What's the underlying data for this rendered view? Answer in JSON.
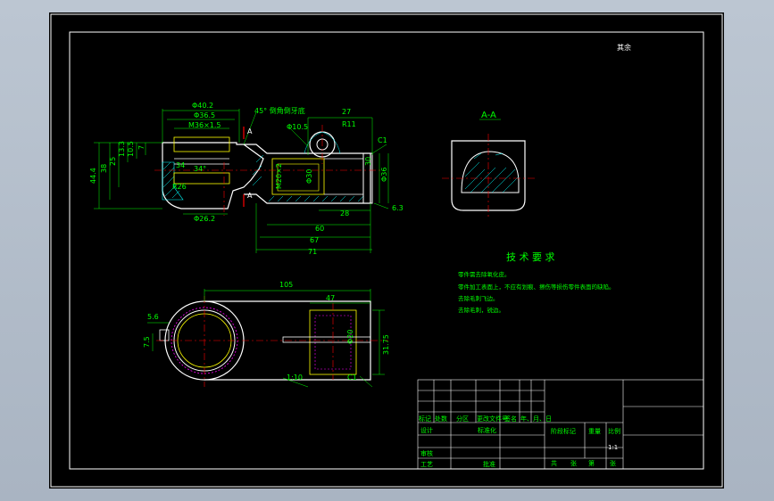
{
  "drawing": {
    "code": "其余",
    "section_title": "A-A",
    "dimensions": {
      "d1": "Φ40.2",
      "d2": "Φ36.5",
      "d3": "M36×1.5",
      "d4": "45° 倒角倒牙底",
      "d5": "27",
      "d6": "R11",
      "d7": "Φ10.5",
      "d8": "C1",
      "d9": "44.4",
      "d10": "38",
      "d11": "25",
      "d12": "13.3",
      "d13": "10.5",
      "d14": "7",
      "d15": "Φ30",
      "d16": "Φ36",
      "d17": "R26",
      "d18": "34°",
      "d19": "Φ26.2",
      "d20": "28",
      "d21": "6.3",
      "d22": "60",
      "d23": "67",
      "d24": "71",
      "d25": "105",
      "d26": "47",
      "d27": "5.6",
      "d28": "7.5",
      "d29": "31.75",
      "d30": "1:10",
      "d31": "C1",
      "d32": "A",
      "d33": "A",
      "d34": "Φ20",
      "d35": "M20×2",
      "d36": "30",
      "d37": "34"
    },
    "tech_requirements": {
      "title": "技 术 要 求",
      "items": [
        "零件需去除氧化皮。",
        "零件加工表面上，不应有划痕、擦伤等损伤零件表面的缺陷。",
        "去除毛刺飞边。",
        "去除毛刺，锐边。"
      ]
    },
    "title_block": {
      "row1": [
        "标记",
        "处数",
        "分区",
        "更改文件号",
        "签名",
        "年、月、日"
      ],
      "row2": [
        "设计",
        "",
        "标准化"
      ],
      "row3": [
        "审核"
      ],
      "row4": [
        "工艺",
        "",
        "批准"
      ],
      "stage_label": "阶段标记",
      "weight_label": "重量",
      "scale_label": "比例",
      "scale": "1:1",
      "sheets": [
        "共",
        "张",
        "第",
        "张"
      ]
    }
  }
}
